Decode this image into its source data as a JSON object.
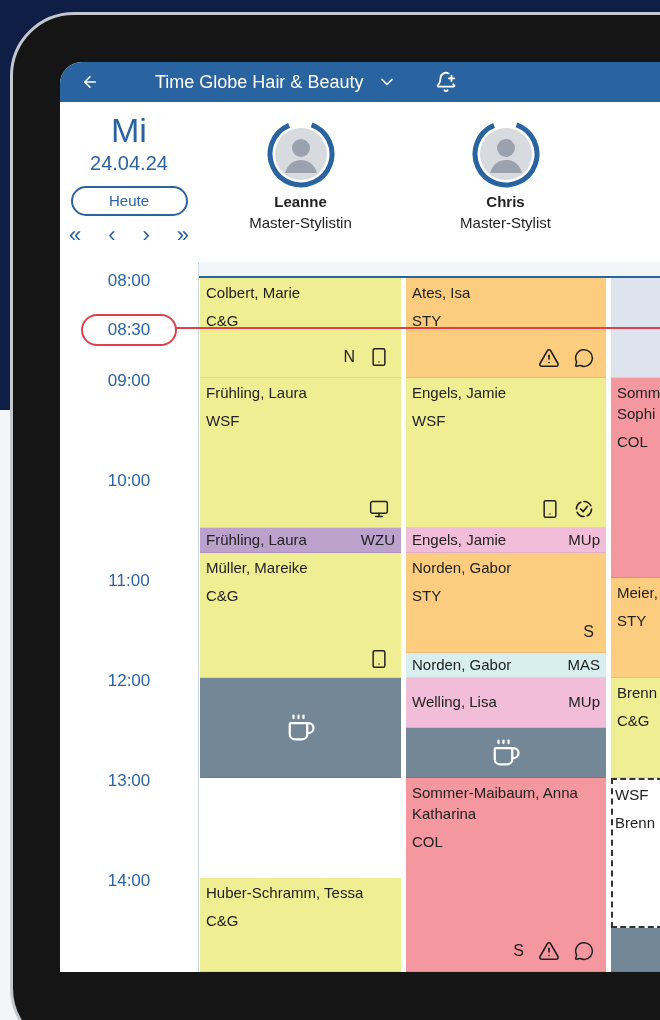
{
  "header": {
    "title": "Time Globe Hair & Beauty"
  },
  "date": {
    "weekday": "Mi",
    "date": "24.04.24",
    "today_button": "Heute",
    "nav": [
      "«",
      "‹",
      "›",
      "»"
    ]
  },
  "staff": [
    {
      "name": "Leanne",
      "role": "Master-Stylistin",
      "level": 0.88
    },
    {
      "name": "Chris",
      "role": "Master-Stylist",
      "level": 0.88
    }
  ],
  "times": [
    {
      "label": "08:00",
      "current": false
    },
    {
      "label": "08:30",
      "current": true
    },
    {
      "label": "09:00",
      "current": false
    },
    {
      "label": "10:00",
      "current": false
    },
    {
      "label": "11:00",
      "current": false
    },
    {
      "label": "12:00",
      "current": false
    },
    {
      "label": "13:00",
      "current": false
    },
    {
      "label": "14:00",
      "current": false
    }
  ],
  "columns": [
    {
      "blocks": [
        {
          "kind": "appointment",
          "color": "#f0ee93",
          "client": "Colbert, Marie",
          "service": "C&G",
          "indicators": [
            {
              "kind": "letter",
              "text": "N"
            },
            {
              "kind": "phone"
            }
          ]
        },
        {
          "kind": "appointment",
          "color": "#f0ee93",
          "client": "Frühling, Laura",
          "service": "WSF",
          "indicators": [
            {
              "kind": "monitor"
            }
          ]
        },
        {
          "kind": "short",
          "color": "#bca1cc",
          "client": "Frühling, Laura",
          "service": "WZU"
        },
        {
          "kind": "appointment",
          "color": "#f0ee93",
          "client": "Müller, Mareike",
          "service": "C&G",
          "indicators": [
            {
              "kind": "phone"
            }
          ]
        },
        {
          "kind": "break",
          "color": "#748797"
        },
        {
          "kind": "empty"
        },
        {
          "kind": "appointment",
          "color": "#f0ee93",
          "client": "Huber-Schramm, Tessa",
          "service": "C&G"
        }
      ]
    },
    {
      "blocks": [
        {
          "kind": "appointment",
          "color": "#fdcd7f",
          "client": "Ates, Isa",
          "service": "STY",
          "indicators": [
            {
              "kind": "warning"
            },
            {
              "kind": "chat"
            }
          ]
        },
        {
          "kind": "appointment",
          "color": "#f0ee93",
          "client": "Engels, Jamie",
          "service": "WSF",
          "indicators": [
            {
              "kind": "phone"
            },
            {
              "kind": "check"
            }
          ]
        },
        {
          "kind": "short",
          "color": "#f2bdd8",
          "client": "Engels, Jamie",
          "service": "MUp"
        },
        {
          "kind": "appointment",
          "color": "#fdcd7f",
          "client": "Norden, Gabor",
          "service": "STY",
          "indicators": [
            {
              "kind": "letter",
              "text": "S"
            }
          ]
        },
        {
          "kind": "short",
          "color": "#d9eeee",
          "client": "Norden, Gabor",
          "service": "MAS"
        },
        {
          "kind": "short",
          "color": "#f2bdd8",
          "client": "Welling, Lisa",
          "service": "MUp"
        },
        {
          "kind": "break",
          "color": "#748797"
        },
        {
          "kind": "appointment",
          "color": "#f4979f",
          "client": "Sommer-Maibaum, Anna Katharina",
          "service": "COL",
          "indicators": [
            {
              "kind": "letter",
              "text": "S"
            },
            {
              "kind": "warning"
            },
            {
              "kind": "chat"
            }
          ]
        }
      ]
    },
    {
      "blocks": [
        {
          "kind": "blocked",
          "color": "#dde4ed"
        },
        {
          "kind": "appointment",
          "color": "#f4979f",
          "client": "Somm Sophi",
          "service": "COL"
        },
        {
          "kind": "appointment",
          "color": "#fdcd7f",
          "client": "Meier,",
          "service": "STY"
        },
        {
          "kind": "appointment",
          "color": "#f0ee93",
          "client": "Brenn",
          "service": "C&G"
        },
        {
          "kind": "tentative",
          "service": "WSF",
          "client": "Brenn"
        },
        {
          "kind": "blocked",
          "color": "#748797"
        }
      ]
    }
  ]
}
